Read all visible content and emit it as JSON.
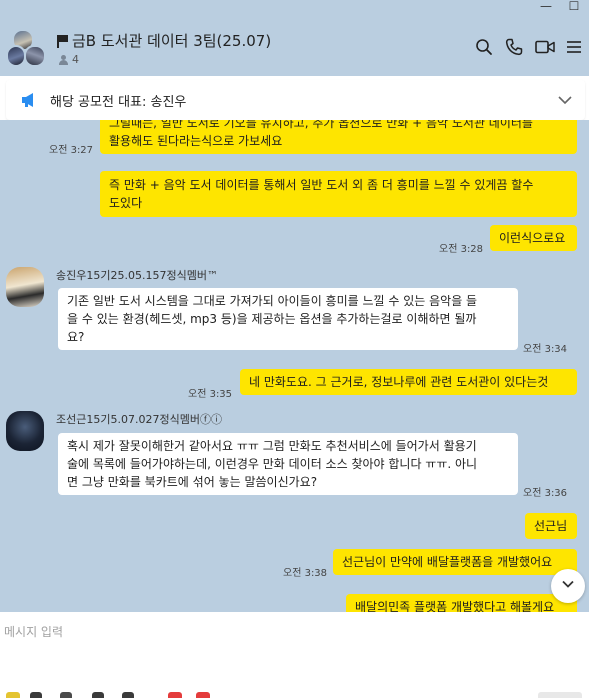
{
  "header": {
    "title": "금B 도서관 데이터 3팀(25.07)",
    "member_count": "4"
  },
  "notice": {
    "text": "해당 공모전 대표: 송진우"
  },
  "messages": {
    "m1": {
      "line1": "그럴때는, 일반 도서로 기오를 유치하고, 추가 옵션으로 만화 + 음악 도서관 데이터를",
      "line2": "활용해도 된다라는식으로 가보세요",
      "time": "오전 3:27"
    },
    "m2": {
      "line1": "즉 만화 + 음악 도서 데이터를 통해서 일반 도서 외 좀 더 흥미를 느낄 수 있게끔 할수",
      "line2": "도있다"
    },
    "m3": {
      "text": "이런식으로요",
      "time": "오전 3:28"
    },
    "sender1": "송진우15기25.05.157정식멤버™",
    "m4": {
      "line1": "기존 일반 도서 시스템을 그대로 가져가되 아이들이 흥미를 느낄 수 있는 음악을 들",
      "line2": "을 수 있는 환경(헤드셋, mp3 등)을 제공하는 옵션을 추가하는걸로 이해하면 될까",
      "line3": "요?",
      "time": "오전 3:34"
    },
    "m5": {
      "text": "네 만화도요. 그 근거로, 정보나루에 관련 도서관이 있다는것",
      "time": "오전 3:35"
    },
    "sender2": "조선근15기5.07.027정식멤버ⓕⓘ",
    "m6": {
      "line1": "혹시 제가 잘못이해한거 같아서요 ㅠㅠ 그럼 만화도 추천서비스에 들어가서 활용기",
      "line2": "술에 목록에 들어가야하는데, 이런경우 만화 데이터 소스 찾아야 합니다 ㅠㅠ. 아니",
      "line3": "면 그냥 만화를 북카트에 섞어 놓는 말씀이신가요?",
      "time": "오전 3:36"
    },
    "m7": {
      "text": "선근님"
    },
    "m8": {
      "text": "선근님이 만약에 배달플랫폼을 개발했어요",
      "time": "오전 3:38"
    },
    "m9": {
      "text": "배달의민족 플랫폼 개발했다고 해볼게요"
    }
  },
  "input": {
    "placeholder": "메시지 입력"
  },
  "colors": {
    "chat_bg": "#bacee0",
    "my_bubble": "#fee500",
    "other_bubble": "#ffffff",
    "notice_icon": "#2a8df0"
  },
  "icons": [
    "flag-icon",
    "person-icon",
    "search-icon",
    "phone-icon",
    "video-icon",
    "menu-icon",
    "announcement-icon",
    "chevron-down-icon"
  ]
}
